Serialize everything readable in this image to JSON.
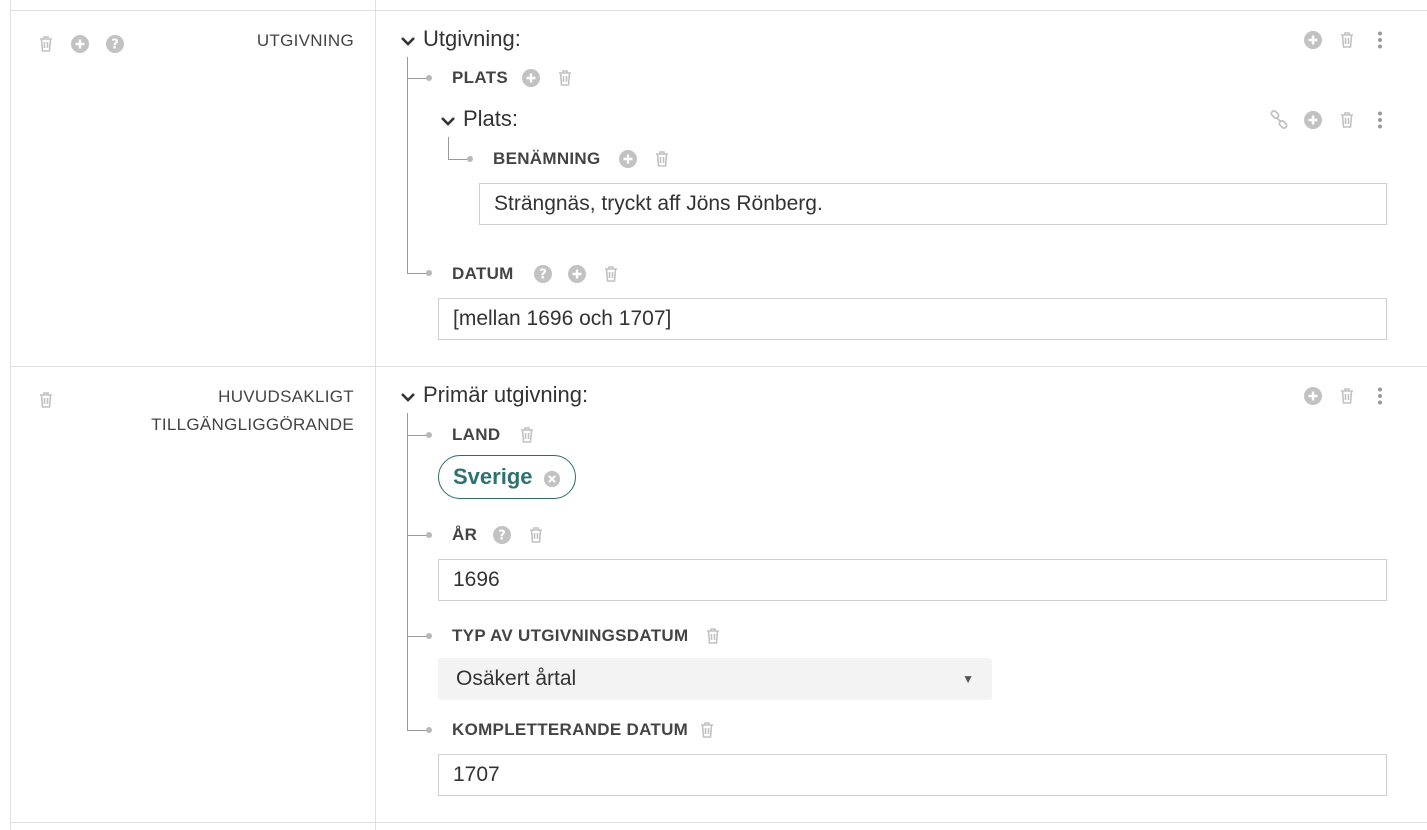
{
  "colors": {
    "icon_gray": "#c2c2c2",
    "chip_teal": "#2f7272",
    "border": "#e0e0e0"
  },
  "section_utgivning": {
    "label": "UTGIVNING",
    "left_icons": [
      "trash-icon",
      "add-circle-icon",
      "help-icon"
    ],
    "heading": "Utgivning:",
    "header_icons": [
      "add-circle-icon",
      "trash-icon",
      "more-vertical-icon"
    ],
    "plats": {
      "label": "PLATS",
      "heading": "Plats:",
      "header_icons": [
        "link-icon",
        "add-circle-icon",
        "trash-icon",
        "more-vertical-icon"
      ],
      "benamning": {
        "label": "BENÄMNING",
        "value": "Strängnäs, tryckt aff Jöns Rönberg."
      }
    },
    "datum": {
      "label": "DATUM",
      "value": "[mellan 1696 och 1707]"
    }
  },
  "section_primar": {
    "label_line1": "HUVUDSAKLIGT",
    "label_line2": "TILLGÄNGLIGGÖRANDE",
    "heading": "Primär utgivning:",
    "land": {
      "label": "LAND",
      "chip": "Sverige"
    },
    "ar": {
      "label": "ÅR",
      "value": "1696"
    },
    "typ": {
      "label": "TYP AV UTGIVNINGSDATUM",
      "selected": "Osäkert årtal"
    },
    "kompletterande": {
      "label": "KOMPLETTERANDE DATUM",
      "value": "1707"
    }
  }
}
